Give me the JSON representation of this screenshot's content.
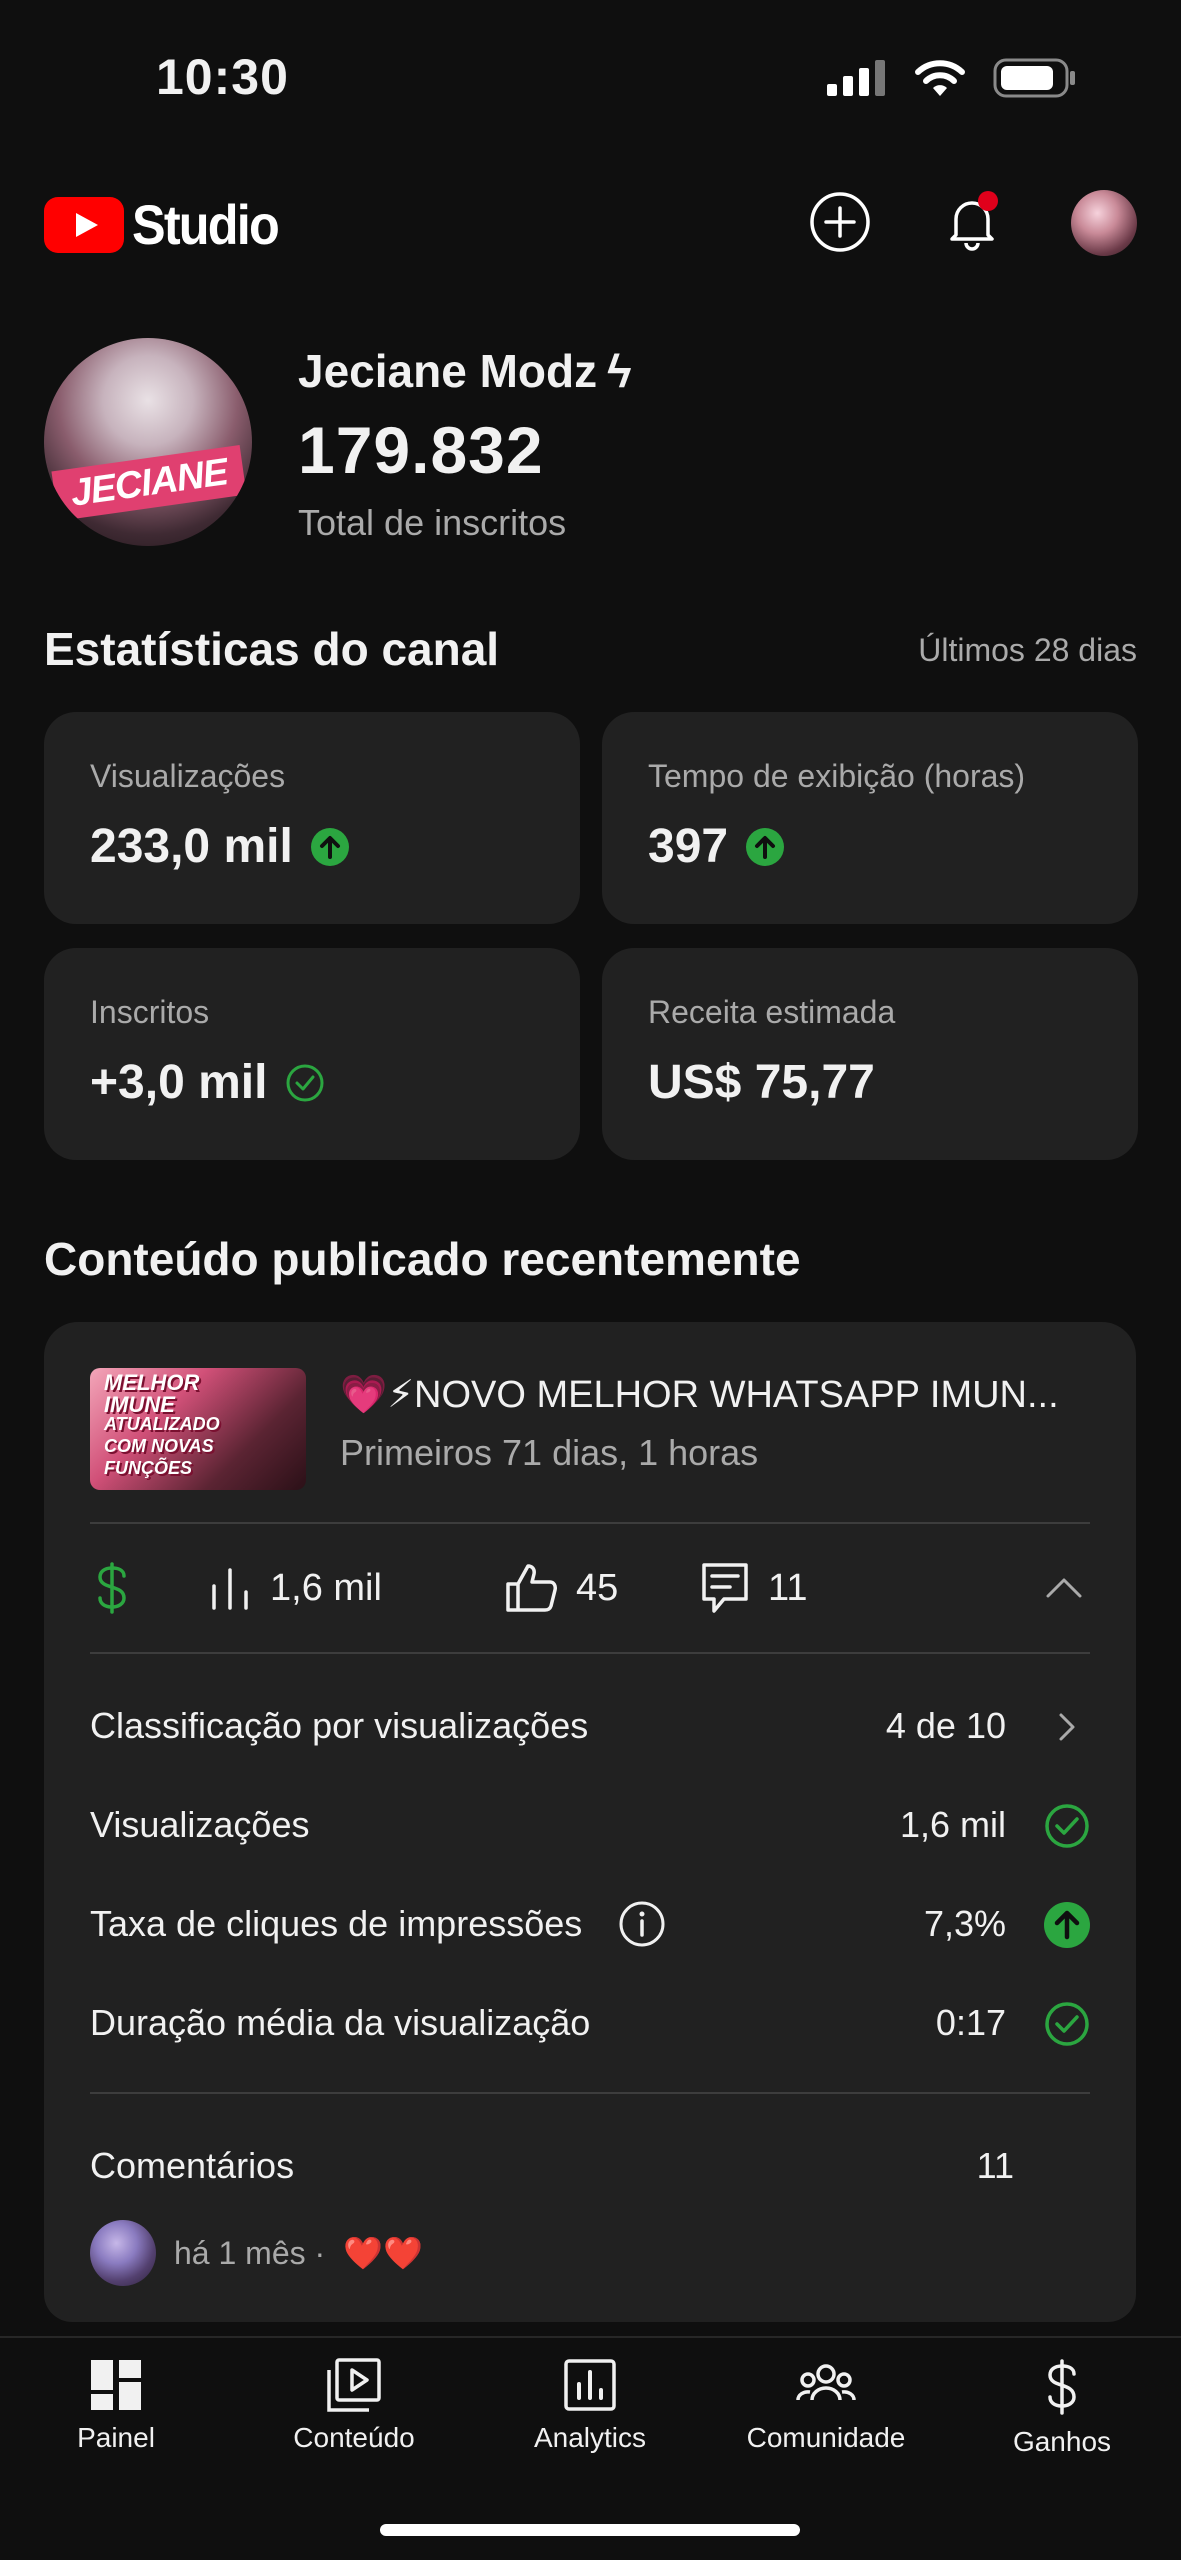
{
  "status_bar": {
    "time": "10:30"
  },
  "header": {
    "logo_text": "Studio"
  },
  "channel": {
    "name": "Jeciane Modz",
    "name_suffix": "ϟ",
    "subscribers": "179.832",
    "subscribers_label": "Total de inscritos",
    "avatar_text": "JECIANE"
  },
  "stats": {
    "title": "Estatísticas do canal",
    "period": "Últimos 28 dias",
    "cards": [
      {
        "label": "Visualizações",
        "value": "233,0 mil",
        "indicator": "up-arrow-icon"
      },
      {
        "label": "Tempo de exibição (horas)",
        "value": "397",
        "indicator": "up-arrow-icon"
      },
      {
        "label": "Inscritos",
        "value": "+3,0 mil",
        "indicator": "check-icon"
      },
      {
        "label": "Receita estimada",
        "value": "US$ 75,77",
        "indicator": ""
      }
    ]
  },
  "recent": {
    "title": "Conteúdo publicado recentemente",
    "video": {
      "title": "💗⚡NOVO MELHOR WHATSAPP IMUN...",
      "subtitle": "Primeiros 71 dias, 1 horas",
      "thumb_lines": [
        "MELHOR",
        "IMUNE",
        "ATUALIZADO",
        "COM NOVAS",
        "FUNÇÕES"
      ]
    },
    "metrics": {
      "views": "1,6 mil",
      "likes": "45",
      "comments": "11"
    },
    "details": [
      {
        "label": "Classificação por visualizações",
        "value": "4 de 10",
        "icon": "chevron-right-icon"
      },
      {
        "label": "Visualizações",
        "value": "1,6 mil",
        "icon": "check-circle-icon"
      },
      {
        "label": "Taxa de cliques de impressões",
        "value": "7,3%",
        "icon": "up-arrow-icon"
      },
      {
        "label": "Duração média da visualização",
        "value": "0:17",
        "icon": "check-circle-icon"
      }
    ],
    "comments": {
      "label": "Comentários",
      "count": "11",
      "latest_time": "há 1 mês ·",
      "latest_text": "❤️❤️"
    }
  },
  "nav": [
    {
      "label": "Painel",
      "icon": "dashboard-icon"
    },
    {
      "label": "Conteúdo",
      "icon": "content-icon"
    },
    {
      "label": "Analytics",
      "icon": "analytics-icon"
    },
    {
      "label": "Comunidade",
      "icon": "community-icon"
    },
    {
      "label": "Ganhos",
      "icon": "earnings-icon"
    }
  ],
  "colors": {
    "background": "#0f0f0f",
    "card": "#212121",
    "accent_green": "#2ba640",
    "youtube_red": "#ff0000",
    "notification_dot": "#e0001b"
  }
}
